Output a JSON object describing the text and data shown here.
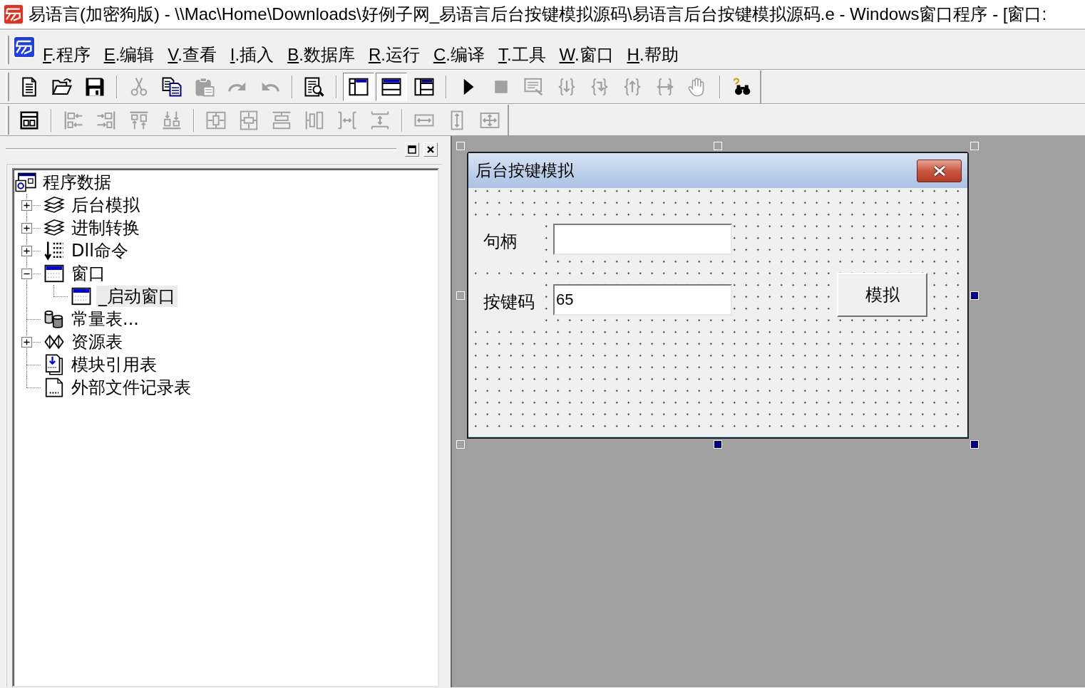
{
  "window": {
    "title": "易语言(加密狗版) - \\\\Mac\\Home\\Downloads\\好例子网_易语言后台按键模拟源码\\易语言后台按键模拟源码.e - Windows窗口程序 - [窗口:"
  },
  "menu_bar": {
    "items": [
      {
        "key": "F",
        "label": ".程序"
      },
      {
        "key": "E",
        "label": ".编辑"
      },
      {
        "key": "V",
        "label": ".查看"
      },
      {
        "key": "I",
        "label": ".插入"
      },
      {
        "key": "B",
        "label": ".数据库"
      },
      {
        "key": "R",
        "label": ".运行"
      },
      {
        "key": "C",
        "label": ".编译"
      },
      {
        "key": "T",
        "label": ".工具"
      },
      {
        "key": "W",
        "label": ".窗口"
      },
      {
        "key": "H",
        "label": ".帮助"
      }
    ]
  },
  "toolbars": [
    {
      "groups": [
        [
          {
            "disabled": false,
            "pressed": false
          },
          {
            "disabled": false,
            "pressed": false
          },
          {
            "disabled": false,
            "pressed": false
          }
        ],
        [
          {
            "disabled": true,
            "pressed": false
          },
          {
            "disabled": false,
            "pressed": false
          },
          {
            "disabled": true,
            "pressed": false
          },
          {
            "disabled": true,
            "pressed": false
          },
          {
            "disabled": true,
            "pressed": false
          }
        ],
        [
          {
            "disabled": false,
            "pressed": false
          }
        ],
        [
          {
            "disabled": false,
            "pressed": true
          },
          {
            "disabled": false,
            "pressed": true
          },
          {
            "disabled": false,
            "pressed": false
          }
        ],
        [
          {
            "disabled": false,
            "pressed": false
          },
          {
            "disabled": true,
            "pressed": false
          },
          {
            "disabled": true,
            "pressed": false
          },
          {
            "disabled": true,
            "pressed": false
          },
          {
            "disabled": true,
            "pressed": false
          },
          {
            "disabled": true,
            "pressed": false
          },
          {
            "disabled": true,
            "pressed": false
          },
          {
            "disabled": true,
            "pressed": false
          }
        ],
        [
          {
            "disabled": false,
            "pressed": false
          }
        ]
      ]
    },
    {
      "groups": [
        [
          {
            "disabled": false,
            "pressed": false
          }
        ],
        [
          {
            "disabled": true,
            "pressed": false
          },
          {
            "disabled": true,
            "pressed": false
          },
          {
            "disabled": true,
            "pressed": false
          },
          {
            "disabled": true,
            "pressed": false
          }
        ],
        [
          {
            "disabled": true,
            "pressed": false
          },
          {
            "disabled": true,
            "pressed": false
          },
          {
            "disabled": true,
            "pressed": false
          },
          {
            "disabled": true,
            "pressed": false
          },
          {
            "disabled": true,
            "pressed": false
          },
          {
            "disabled": true,
            "pressed": false
          }
        ],
        [
          {
            "disabled": true,
            "pressed": false
          },
          {
            "disabled": true,
            "pressed": false
          },
          {
            "disabled": true,
            "pressed": false
          }
        ]
      ]
    }
  ],
  "project_panel": {
    "tree": {
      "root": {
        "label": "程序数据",
        "selected": false,
        "children": [
          {
            "kind": "module",
            "label": "后台模拟",
            "expandable": true,
            "expanded": false,
            "selected": false
          },
          {
            "kind": "module",
            "label": "进制转换",
            "expandable": true,
            "expanded": false,
            "selected": false
          },
          {
            "kind": "dll",
            "label": "Dll命令",
            "expandable": true,
            "expanded": false,
            "selected": false
          },
          {
            "kind": "window",
            "label": "窗口",
            "expandable": true,
            "expanded": true,
            "selected": false,
            "children": [
              {
                "kind": "window",
                "label": "_启动窗口",
                "expandable": false,
                "expanded": false,
                "selected": true
              }
            ]
          },
          {
            "kind": "constants",
            "label": "常量表...",
            "expandable": false,
            "expanded": false,
            "selected": false
          },
          {
            "kind": "resources",
            "label": "资源表",
            "expandable": true,
            "expanded": false,
            "selected": false
          },
          {
            "kind": "module-refs",
            "label": "模块引用表",
            "expandable": false,
            "expanded": false,
            "selected": false
          },
          {
            "kind": "external-files",
            "label": "外部文件记录表",
            "expandable": false,
            "expanded": false,
            "selected": false
          }
        ]
      }
    }
  },
  "designer": {
    "handles": [
      {
        "filled": false
      },
      {
        "filled": false
      },
      {
        "filled": false
      },
      {
        "filled": false
      },
      {
        "filled": true
      },
      {
        "filled": false
      },
      {
        "filled": true
      },
      {
        "filled": true
      }
    ],
    "form": {
      "title": "后台按键模拟",
      "fields": [
        {
          "label": "句柄"
        },
        {
          "label": "按键码",
          "value": "65"
        }
      ],
      "button": "模拟"
    }
  }
}
